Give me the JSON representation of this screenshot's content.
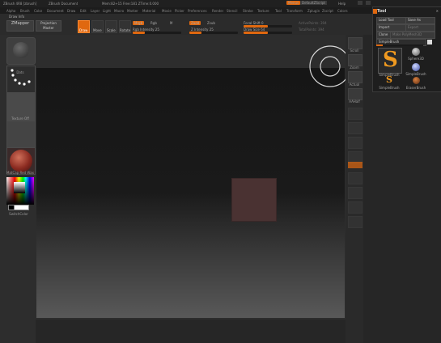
{
  "titlebar": {
    "app": "ZBrush 4R8 [zbrush]",
    "document": "ZBrush Document",
    "stats": "Mem:82+15 Free:181 ZTime:0.000",
    "menus_btn": "Menus",
    "default_script": "DefaultZScript",
    "help": "Help"
  },
  "menubar": {
    "items": [
      "Alpha",
      "Brush",
      "Color",
      "Document",
      "Draw",
      "Edit",
      "Layer",
      "Light",
      "Macro",
      "Marker",
      "Material",
      "Movie",
      "Picker",
      "Preferences",
      "Render",
      "Stencil",
      "Stroke",
      "Texture",
      "Tool",
      "Transform",
      "Zplugin",
      "Zscript",
      "Colors"
    ]
  },
  "toolbar": {
    "home_label": "Draw Info",
    "zmapper": "ZMapper",
    "projection_master": "Projection Master",
    "buttons": [
      "Draw",
      "Move",
      "Scale",
      "Rotate"
    ],
    "mrgb": "Mrgb",
    "rgb": "Rgb",
    "m": "M",
    "rgb_intensity": "Rgb Intensity 25",
    "zadd": "Zadd",
    "zsub": "Zsub",
    "z_intensity": "Z Intensity 25",
    "focal_shift": "Focal Shift 0",
    "draw_size": "Draw Size 64",
    "active_points": "ActivePoints: 394",
    "total_points": "TotalPoints: 394",
    "accent": "#e0680f"
  },
  "leftshelf": {
    "swatch_labels": [
      "Standard",
      "Dots",
      "Alpha Off",
      "Texture Off",
      "MatCap Red Wax"
    ],
    "switch_color": "SwitchColor"
  },
  "rightshelf": {
    "labels": [
      "Scroll",
      "Zoom",
      "Actual",
      "AAHalf"
    ]
  },
  "toolpal": {
    "title": "Tool",
    "load": "Load Tool",
    "save": "Save As",
    "import": "Import",
    "export": "Export",
    "clone": "Clone",
    "make": "Make PolyMesh3D",
    "current": "SimpleBrush",
    "items": [
      "SimpleBrush",
      "Sphere3D",
      "SimpleBrush",
      "EraserBrush"
    ],
    "current_label": "SimpleBrush"
  }
}
